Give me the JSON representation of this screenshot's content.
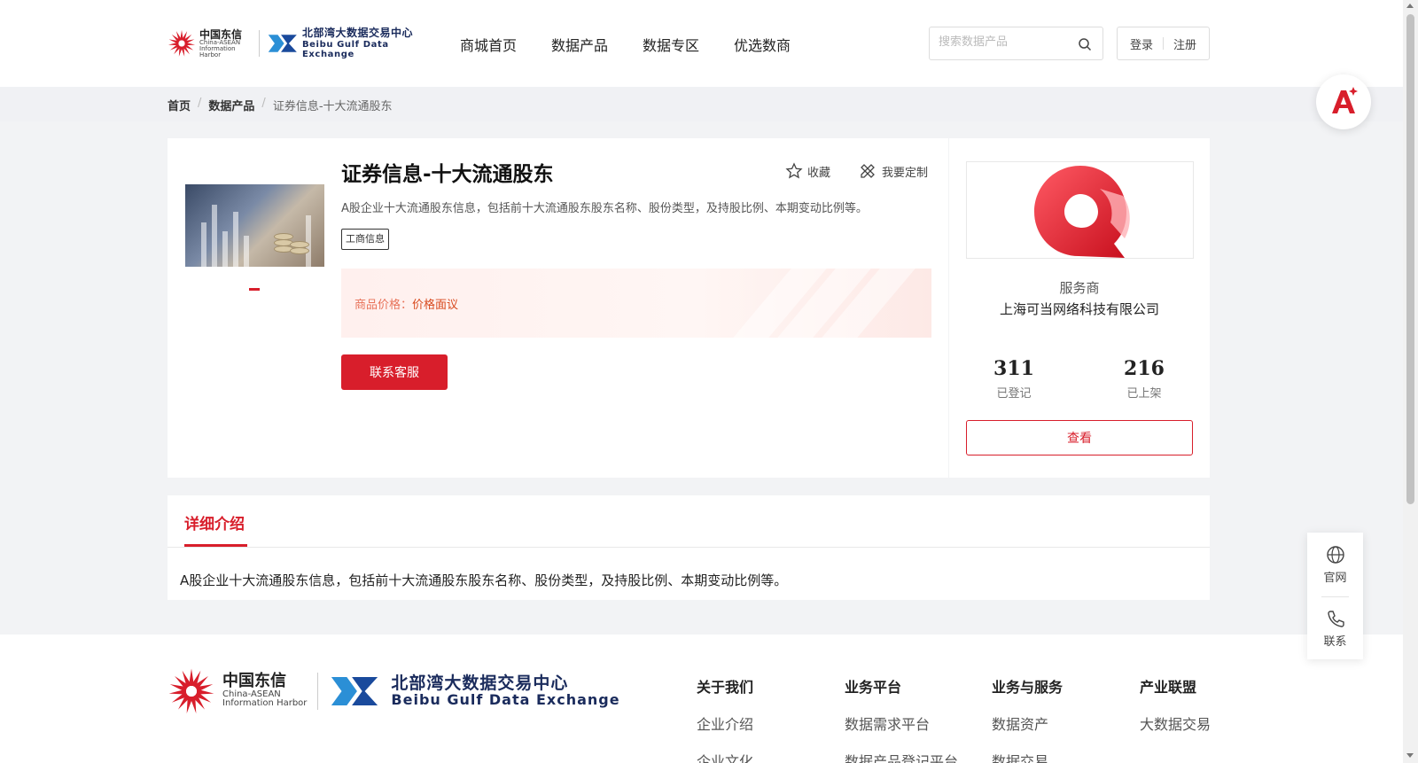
{
  "header": {
    "logo_cn_big": "中国东信",
    "logo_cn_small1": "China-ASEAN",
    "logo_cn_small2": "Information Harbor",
    "logo_bg_big": "北部湾大数据交易中心",
    "logo_bg_small": "Beibu Gulf Data Exchange",
    "nav": [
      "商城首页",
      "数据产品",
      "数据专区",
      "优选数商"
    ],
    "search_placeholder": "搜索数据产品",
    "login": "登录",
    "register": "注册"
  },
  "breadcrumb": [
    "首页",
    "数据产品",
    "证券信息-十大流通股东"
  ],
  "product": {
    "title": "证券信息-十大流通股东",
    "favorite": "收藏",
    "customize": "我要定制",
    "description": "A股企业十大流通股东信息，包括前十大流通股东股东名称、股份类型，及持股比例、本期变动比例等。",
    "tag": "工商信息",
    "price_label": "商品价格：",
    "price_value": "价格面议",
    "contact_button": "联系客服"
  },
  "provider": {
    "label": "服务商",
    "name": "上海可当网络科技有限公司",
    "registered_count": "311",
    "registered_label": "已登记",
    "listed_count": "216",
    "listed_label": "已上架",
    "view_button": "查看"
  },
  "detail": {
    "tab": "详细介绍",
    "text": "A股企业十大流通股东信息，包括前十大流通股东股东名称、股份类型，及持股比例、本期变动比例等。"
  },
  "footer": {
    "columns": [
      {
        "heading": "关于我们",
        "items": [
          "企业介绍",
          "企业文化"
        ]
      },
      {
        "heading": "业务平台",
        "items": [
          "数据需求平台",
          "数据产品登记平台"
        ]
      },
      {
        "heading": "业务与服务",
        "items": [
          "数据资产",
          "数据交易"
        ]
      },
      {
        "heading": "产业联盟",
        "items": [
          "大数据交易"
        ]
      }
    ]
  },
  "float_panel": {
    "official": "官网",
    "contact": "联系"
  },
  "colors": {
    "brand_red": "#d81e2b",
    "price_orange": "#d84a1f",
    "logo_navy": "#1a2b5c"
  }
}
